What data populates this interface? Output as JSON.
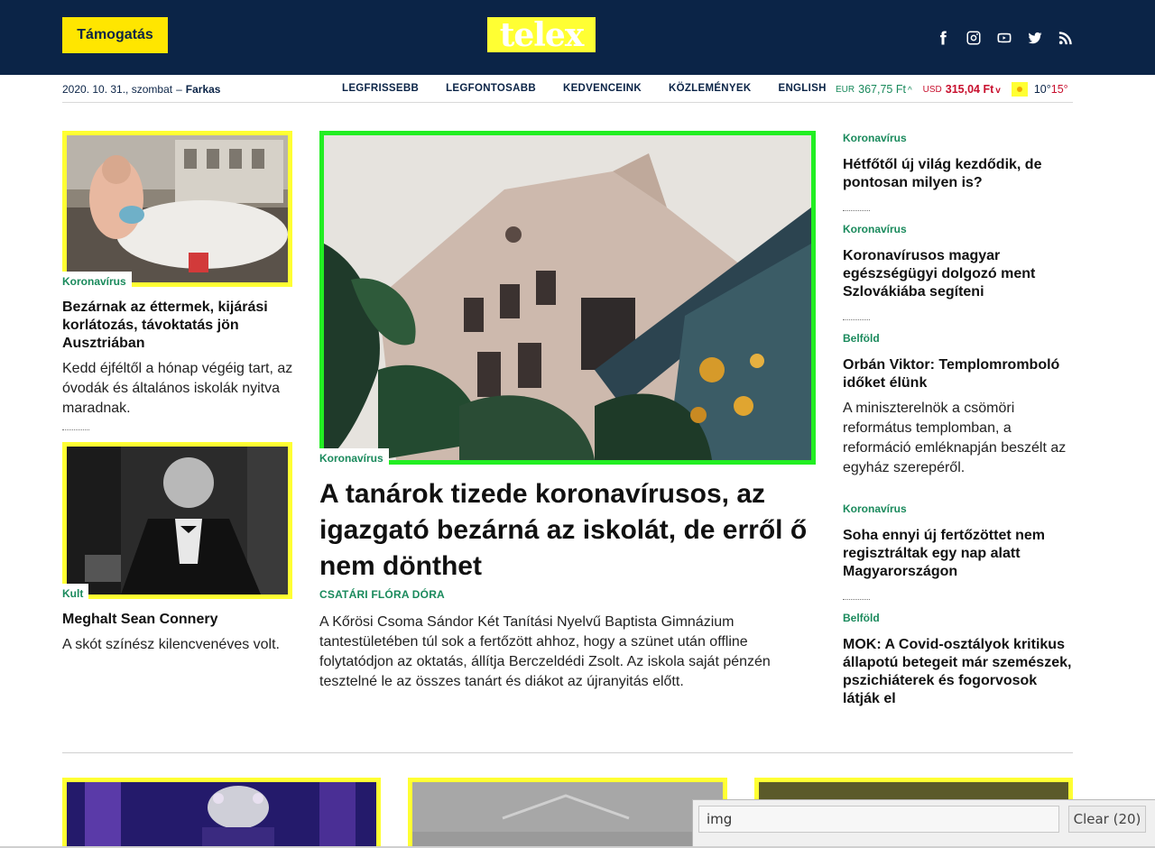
{
  "header": {
    "support_label": "Támogatás",
    "logo_text": "telex",
    "social_icons": [
      "facebook-icon",
      "instagram-icon",
      "youtube-icon",
      "twitter-icon",
      "rss-icon"
    ]
  },
  "subbar": {
    "date": "2020. 10. 31., szombat",
    "separator": "–",
    "nameday": "Farkas",
    "nav": [
      "LEGFRISSEBB",
      "LEGFONTOSABB",
      "KEDVENCEINK",
      "KÖZLEMÉNYEK",
      "ENGLISH"
    ],
    "eur_label": "EUR",
    "eur_value": "367,75 Ft",
    "eur_trend": "^",
    "usd_label": "USD",
    "usd_value": "315,04 Ft",
    "usd_trend": "v",
    "temp_min": "10°",
    "temp_max": "15°"
  },
  "left_articles": [
    {
      "tag": "Koronavírus",
      "title": "Bezárnak az éttermek, kijárási korlátozás, távoktatás jön Ausztriában",
      "lead": "Kedd éjféltől a hónap végéig tart, az óvodák és általános iskolák nyitva maradnak."
    },
    {
      "tag": "Kult",
      "title": "Meghalt Sean Connery",
      "lead": "A skót színész kilencvenéves volt."
    }
  ],
  "main_article": {
    "tag": "Koronavírus",
    "title": "A tanárok tizede koronavírusos, az igazgató bezárná az iskolát, de erről ő nem dönthet",
    "author": "CSATÁRI FLÓRA DÓRA",
    "lead": "A Kőrösi Csoma Sándor Két Tanítási Nyelvű Baptista Gimnázium tantestületében túl sok a fertőzött ahhoz, hogy a szünet után offline folytatódjon az oktatás, állítja Berczeldédi Zsolt. Az iskola saját pénzén tesztelné le az összes tanárt és diákot az újranyitás előtt."
  },
  "right_articles": [
    {
      "tag": "Koronavírus",
      "title": "Hétfőtől új világ kezdődik, de pontosan milyen is?"
    },
    {
      "tag": "Koronavírus",
      "title": "Koronavírusos magyar egészségügyi dolgozó ment Szlovákiába segíteni"
    },
    {
      "tag": "Belföld",
      "title": "Orbán Viktor: Templomromboló időket élünk",
      "lead": "A miniszterelnök a csömöri református templomban, a reformáció emléknapján beszélt az egyház szerepéről."
    },
    {
      "tag": "Koronavírus",
      "title": "Soha ennyi új fertőzöttet nem regisztráltak egy nap alatt Magyarországon"
    },
    {
      "tag": "Belföld",
      "title": "MOK: A Covid-osztályok kritikus állapotú betegeit már szemészek, pszichiáterek és fogorvosok látják el"
    }
  ],
  "findbar": {
    "query": "img",
    "clear_label": "Clear (20)"
  },
  "colors": {
    "header_bg": "#0b2447",
    "accent_yellow": "#ffe600",
    "frame_yellow": "#ffff33",
    "frame_green": "#22ee22",
    "tag_green": "#1a8a5c",
    "usd_red": "#c8102e"
  }
}
